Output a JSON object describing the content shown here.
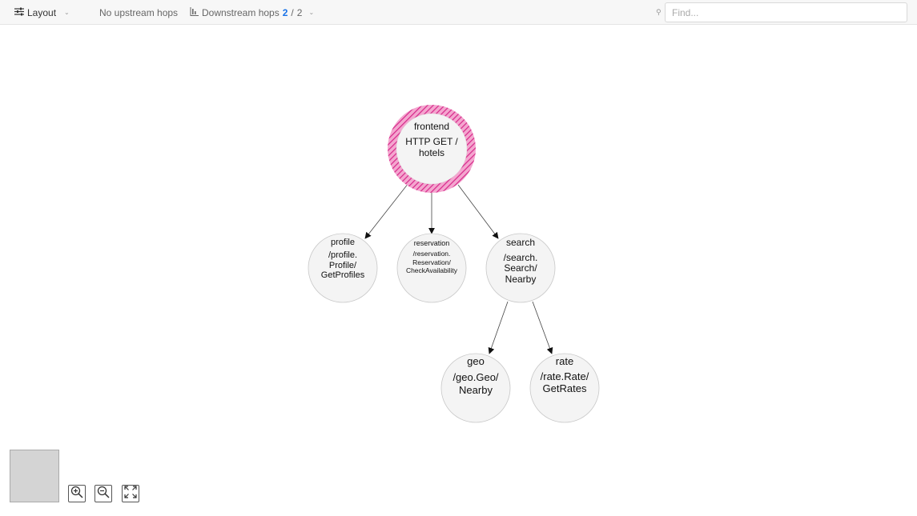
{
  "toolbar": {
    "layout_label": "Layout",
    "upstream_label": "No upstream hops",
    "downstream_label": "Downstream hops",
    "downstream_current": "2",
    "downstream_separator": "/",
    "downstream_total": "2",
    "find_placeholder": "Find..."
  },
  "graph": {
    "root": {
      "service": "frontend",
      "op_lines": [
        "HTTP GET /",
        "hotels"
      ]
    },
    "children": [
      {
        "service": "profile",
        "op_lines": [
          "/profile.",
          "Profile/",
          "GetProfiles"
        ]
      },
      {
        "service": "reservation",
        "op_lines": [
          "/reservation.",
          "Reservation/",
          "CheckAvailability"
        ]
      },
      {
        "service": "search",
        "op_lines": [
          "/search.",
          "Search/",
          "Nearby"
        ]
      }
    ],
    "grandchildren": [
      {
        "service": "geo",
        "op_lines": [
          "/geo.Geo/",
          "Nearby"
        ]
      },
      {
        "service": "rate",
        "op_lines": [
          "/rate.Rate/",
          "GetRates"
        ]
      }
    ],
    "colors": {
      "root_ring": "#e0409a",
      "node_fill": "#f4f4f4",
      "node_stroke": "#c8c8c8",
      "edge": "#444444"
    }
  },
  "controls": {
    "icons": [
      "zoom-in-icon",
      "zoom-out-icon",
      "fit-view-icon"
    ]
  }
}
